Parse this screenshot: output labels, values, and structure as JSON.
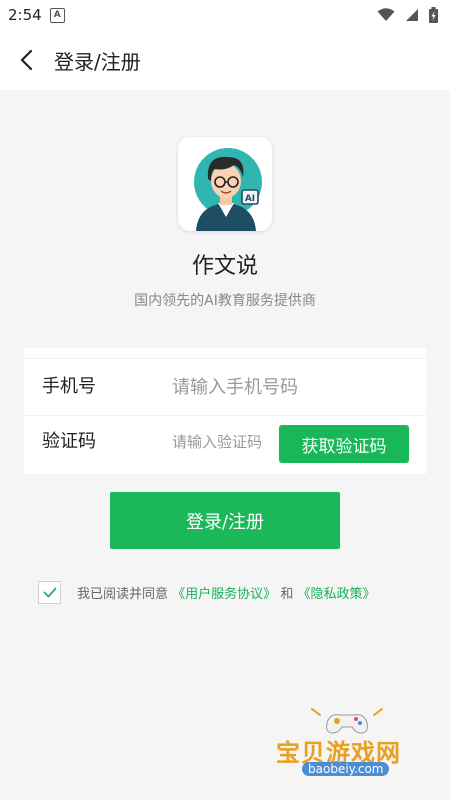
{
  "status_bar": {
    "time": "2:54",
    "notification_icon": "A"
  },
  "app_bar": {
    "title": "登录/注册"
  },
  "brand": {
    "app_name": "作文说",
    "slogan": "国内领先的AI教育服务提供商",
    "logo_badge": "AI"
  },
  "form": {
    "phone_label": "手机号",
    "phone_placeholder": "请输入手机号码",
    "code_label": "验证码",
    "code_placeholder": "请输入验证码",
    "get_code_button": "获取验证码"
  },
  "login_button": "登录/注册",
  "agreement": {
    "checked": true,
    "prefix": "我已阅读并同意",
    "user_agreement": "《用户服务协议》",
    "conjunction": "和",
    "privacy_policy": "《隐私政策》"
  },
  "watermark": {
    "title": "宝贝游戏网",
    "url": "baobeiy.com"
  },
  "colors": {
    "accent": "#1bb85a",
    "background": "#f5f5f5",
    "watermark": "#e9a020"
  }
}
